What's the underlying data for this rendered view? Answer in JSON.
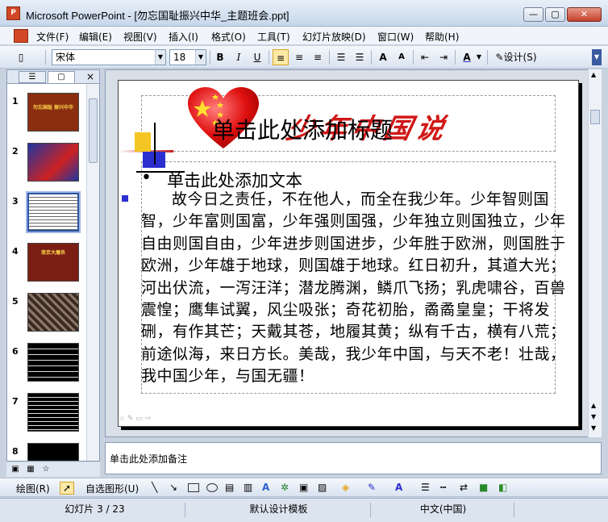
{
  "window": {
    "title": "Microsoft PowerPoint - [勿忘国耻振兴中华_主题班会.ppt]",
    "app_icon_text": "P",
    "buttons": {
      "minimize": "—",
      "maximize": "▢",
      "close": "✕"
    }
  },
  "menubar": {
    "items": [
      "文件(F)",
      "编辑(E)",
      "视图(V)",
      "插入(I)",
      "格式(O)",
      "工具(T)",
      "幻灯片放映(D)",
      "窗口(W)",
      "帮助(H)"
    ]
  },
  "toolbar": {
    "font": "宋体",
    "font_size": "18",
    "bold": "B",
    "italic": "I",
    "underline": "U",
    "design_label": "设计(S)"
  },
  "left_panel": {
    "close": "×",
    "slides": [
      {
        "num": "1",
        "title": "勿忘国耻 振兴中华",
        "bg": "#8b2e10"
      },
      {
        "num": "2",
        "title": "",
        "bg": "#2035a0"
      },
      {
        "num": "3",
        "title": "",
        "bg": "#ffffff"
      },
      {
        "num": "4",
        "title": "南京大屠杀",
        "bg": "#7a1e14"
      },
      {
        "num": "5",
        "title": "",
        "bg": "#3a2a22"
      },
      {
        "num": "6",
        "title": "",
        "bg": "#000000"
      },
      {
        "num": "7",
        "title": "",
        "bg": "#000000"
      },
      {
        "num": "8",
        "title": "",
        "bg": "#000000"
      }
    ]
  },
  "slide": {
    "title_placeholder": "单击此处添加标题",
    "banner": "少年中国说",
    "body_placeholder": "单击此处添加文本",
    "bullet": "•",
    "poem": "故今日之责任，不在他人，而全在我少年。少年智则国智，少年富则国富，少年强则国强，少年独立则国独立，少年自由则国自由，少年进步则国进步，少年胜于欧洲，则国胜于欧洲，少年雄于地球，则国雄于地球。红日初升，其道大光；河出伏流，一泻汪洋；潜龙腾渊，鳞爪飞扬；乳虎啸谷，百兽震惶；鹰隼试翼，风尘吸张；奇花初胎，矞矞皇皇；干将发硎，有作其芒；天戴其苍，地履其黄；纵有千古，横有八荒；前途似海，来日方长。美哉，我少年中国，与天不老！壮哉，我中国少年，与国无疆！"
  },
  "notes": {
    "placeholder": "单击此处添加备注"
  },
  "drawbar": {
    "draw": "绘图(R)",
    "autoshapes": "自选图形(U)"
  },
  "statusbar": {
    "slide_index": "幻灯片 3 / 23",
    "template": "默认设计模板",
    "language": "中文(中国)"
  },
  "colors": {
    "accent_red": "#d01818",
    "selection_blue": "#2e55a4"
  }
}
